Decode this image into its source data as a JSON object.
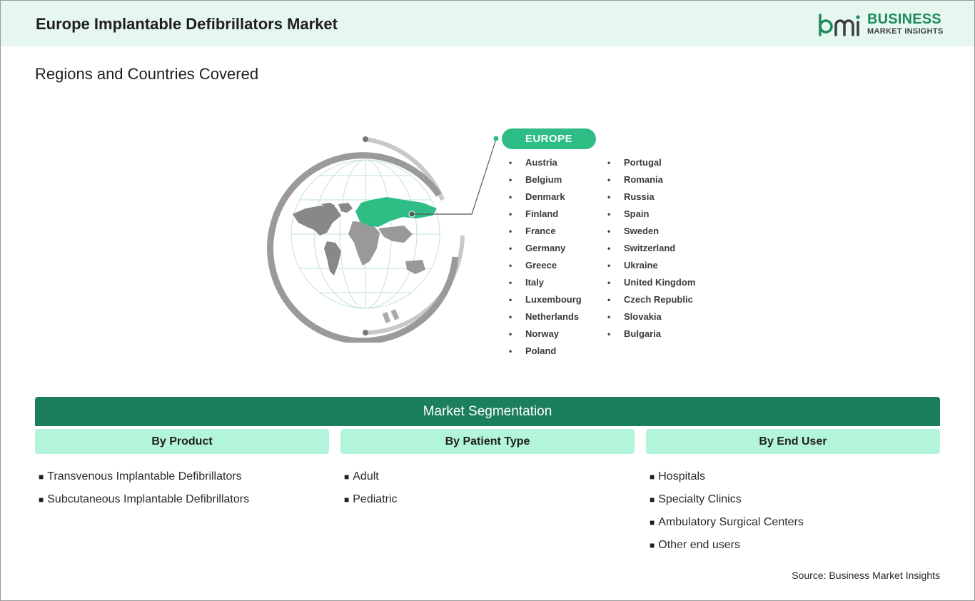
{
  "header": {
    "title": "Europe Implantable Defibrillators Market",
    "logo_line1": "BUSINESS",
    "logo_line2": "MARKET INSIGHTS"
  },
  "regions": {
    "heading": "Regions and Countries Covered",
    "region_label": "EUROPE",
    "countries_col1": [
      "Austria",
      "Belgium",
      "Denmark",
      "Finland",
      "France",
      "Germany",
      "Greece",
      "Italy",
      "Luxembourg",
      "Netherlands",
      "Norway",
      "Poland"
    ],
    "countries_col2": [
      "Portugal",
      "Romania",
      "Russia",
      "Spain",
      "Sweden",
      "Switzerland",
      "Ukraine",
      "United Kingdom",
      "Czech Republic",
      "Slovakia",
      "Bulgaria"
    ]
  },
  "segmentation": {
    "title": "Market Segmentation",
    "columns": [
      {
        "heading": "By Product",
        "items": [
          "Transvenous Implantable Defibrillators",
          "Subcutaneous Implantable Defibrillators"
        ]
      },
      {
        "heading": "By Patient Type",
        "items": [
          "Adult",
          "Pediatric"
        ]
      },
      {
        "heading": "By End User",
        "items": [
          "Hospitals",
          "Specialty Clinics",
          "Ambulatory Surgical Centers",
          "Other end users"
        ]
      }
    ]
  },
  "source": "Source: Business Market Insights",
  "colors": {
    "header_bg": "#e6f7ef",
    "accent_green": "#2ebd85",
    "dark_green": "#1a7f5a",
    "light_green": "#b3f5da"
  }
}
